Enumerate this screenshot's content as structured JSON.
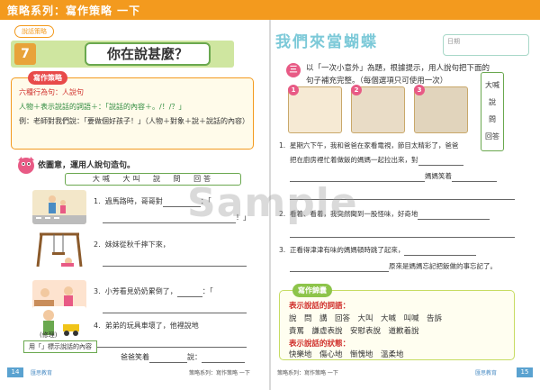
{
  "header": {
    "title": "策略系列：寫作策略 一下"
  },
  "left": {
    "tag": "說話策略",
    "lesson_number": "7",
    "lesson_title": "你在說甚麼？",
    "strategy_box": {
      "tag": "寫作策略",
      "lines": [
        "六種行為句：人說句",
        "人物＋表示說話的詞語＋：「說話的內容＋。/！/？」",
        "例：老師對我們說：「要做個好孩子！」（人物＋對象＋說＋說話的內容）"
      ]
    },
    "instruction": "依圖意，運用人說句造句。",
    "word_bank": [
      "大喊",
      "大叫",
      "說",
      "問",
      "回答"
    ],
    "exercises": [
      {
        "num": "1.",
        "text_a": "過馬路時，哥哥對",
        "text_b": "：「",
        "text_c": "",
        "text_d": "！」"
      },
      {
        "num": "2.",
        "text_a": "妹妹從秋千摔下來，"
      },
      {
        "num": "3.",
        "text_a": "小芳看見奶奶累倒了，",
        "text_b": "：「"
      },
      {
        "num": "4.",
        "text_a": "弟弟的玩具車壞了，他裡說地",
        "text_b": "爸爸笑着",
        "text_c": "說："
      }
    ],
    "repair_label": "(修理)",
    "note": "用「」標示說話的內容",
    "page_number": "14",
    "publisher": "匯思教育",
    "footer_title": "策略系列：寫作策略 一下"
  },
  "right": {
    "header_art": "我們來當蝴蝶",
    "date_label": "日期",
    "step_num": "三",
    "instruction_lines": [
      "以「一次小意外」為題，根據提示，用人說句把下面的",
      "句子補充完整。（每個選項只可使用一次）"
    ],
    "vertical_words": [
      "大喊",
      "說",
      "問",
      "回答"
    ],
    "scene_numbers": [
      "1",
      "2",
      "3",
      "4"
    ],
    "items": [
      {
        "num": "1.",
        "line1": "星期六下午，我和爸爸在家看電視，節目太精彩了，爸爸",
        "line2": "把在廚房裡忙着做飯的媽媽一起拉出來，對",
        "line3": "媽媽笑着"
      },
      {
        "num": "2.",
        "line1": "看着、看着，我突然聞到一股怪味，好奇地"
      },
      {
        "num": "3.",
        "line1": "正看得津津有味的媽媽頓時跳了起來，",
        "line2": "原來是媽媽忘記把飯做的事忘記了。"
      }
    ],
    "writing_box": {
      "tag": "寫作錦囊",
      "head1": "表示說話的詞語：",
      "row1": "說　問　講　回答　大叫　大喊　叫喊　告訴",
      "row2": "責罵　謙虛表說　安慰表說　道歉着說",
      "head2": "表示說話的狀態：",
      "row3": "快樂地　傷心地　慚愧地　溫柔地"
    },
    "page_number": "15",
    "publisher": "匯思教育",
    "footer_title": "策略系列：寫作策略 一下"
  },
  "watermark": "Sample"
}
